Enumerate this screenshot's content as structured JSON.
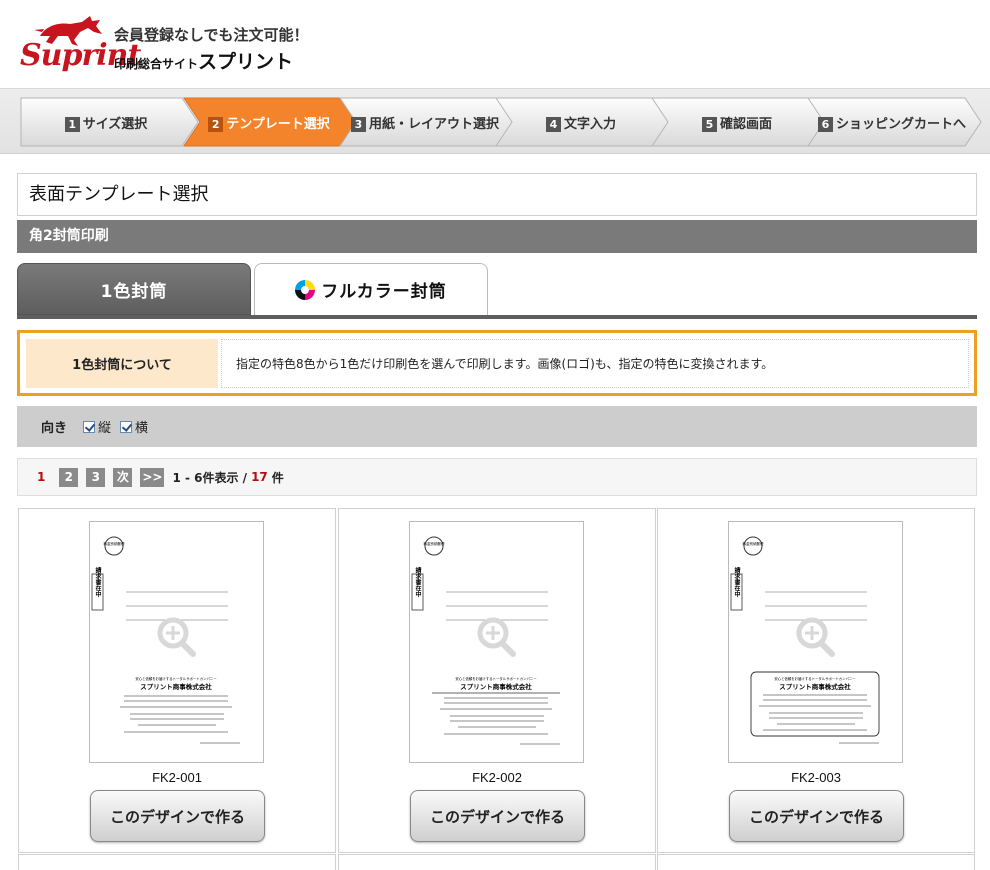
{
  "header": {
    "logo": "Suprint",
    "tagline": "会員登録なしでも注文可能！",
    "site_label_small": "印刷総合サイト",
    "site_label_big": "スプリント"
  },
  "steps": [
    {
      "num": "1",
      "label": "サイズ選択",
      "active": false
    },
    {
      "num": "2",
      "label": "テンプレート選択",
      "active": true
    },
    {
      "num": "3",
      "label": "用紙・レイアウト選択",
      "active": false
    },
    {
      "num": "4",
      "label": "文字入力",
      "active": false
    },
    {
      "num": "5",
      "label": "確認画面",
      "active": false
    },
    {
      "num": "6",
      "label": "ショッピングカートへ",
      "active": false
    }
  ],
  "section_title": "表面テンプレート選択",
  "section_subtitle": "角2封筒印刷",
  "tabs": {
    "one_color": "1色封筒",
    "full_color": "フルカラー封筒"
  },
  "info": {
    "label": "1色封筒について",
    "text": "指定の特色8色から1色だけ印刷色を選んで印刷します。画像(ロゴ)も、指定の特色に変換されます。"
  },
  "filter": {
    "label": "向き",
    "options": [
      "縦",
      "横"
    ]
  },
  "pager": {
    "current": "1",
    "pages": [
      "2",
      "3"
    ],
    "next": "次",
    "last": ">>",
    "range": "1 - 6件表示 /",
    "total": "17",
    "unit": "件"
  },
  "templates": [
    {
      "code": "FK2-001",
      "button": "このデザインで作る"
    },
    {
      "code": "FK2-002",
      "button": "このデザインで作る"
    },
    {
      "code": "FK2-003",
      "button": "このデザインで作る"
    }
  ],
  "thumb_text": {
    "stamp": "料金別納郵便",
    "vertical": "請求書在中",
    "company": "スプリント商事株式会社",
    "catch": "安心と信頼をお届けするトータルサポートカンパニー"
  },
  "colors": {
    "active_step": "#f3842b",
    "accent_red": "#c8141e",
    "info_border": "#f0a020",
    "info_label_bg": "#fde8cc"
  }
}
